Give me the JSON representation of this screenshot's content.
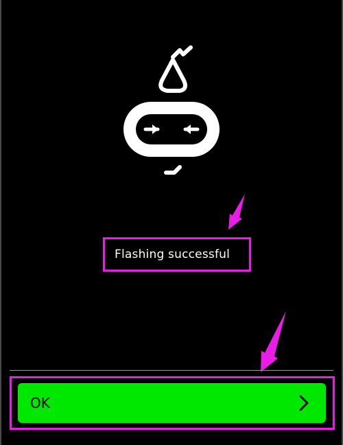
{
  "message": {
    "text": "Flashing successful"
  },
  "primary_action": {
    "label": "OK",
    "icon": "chevron-right-icon"
  },
  "colors": {
    "background": "#000000",
    "button_green": "#00e800",
    "annotation_magenta": "#e81ee6"
  }
}
